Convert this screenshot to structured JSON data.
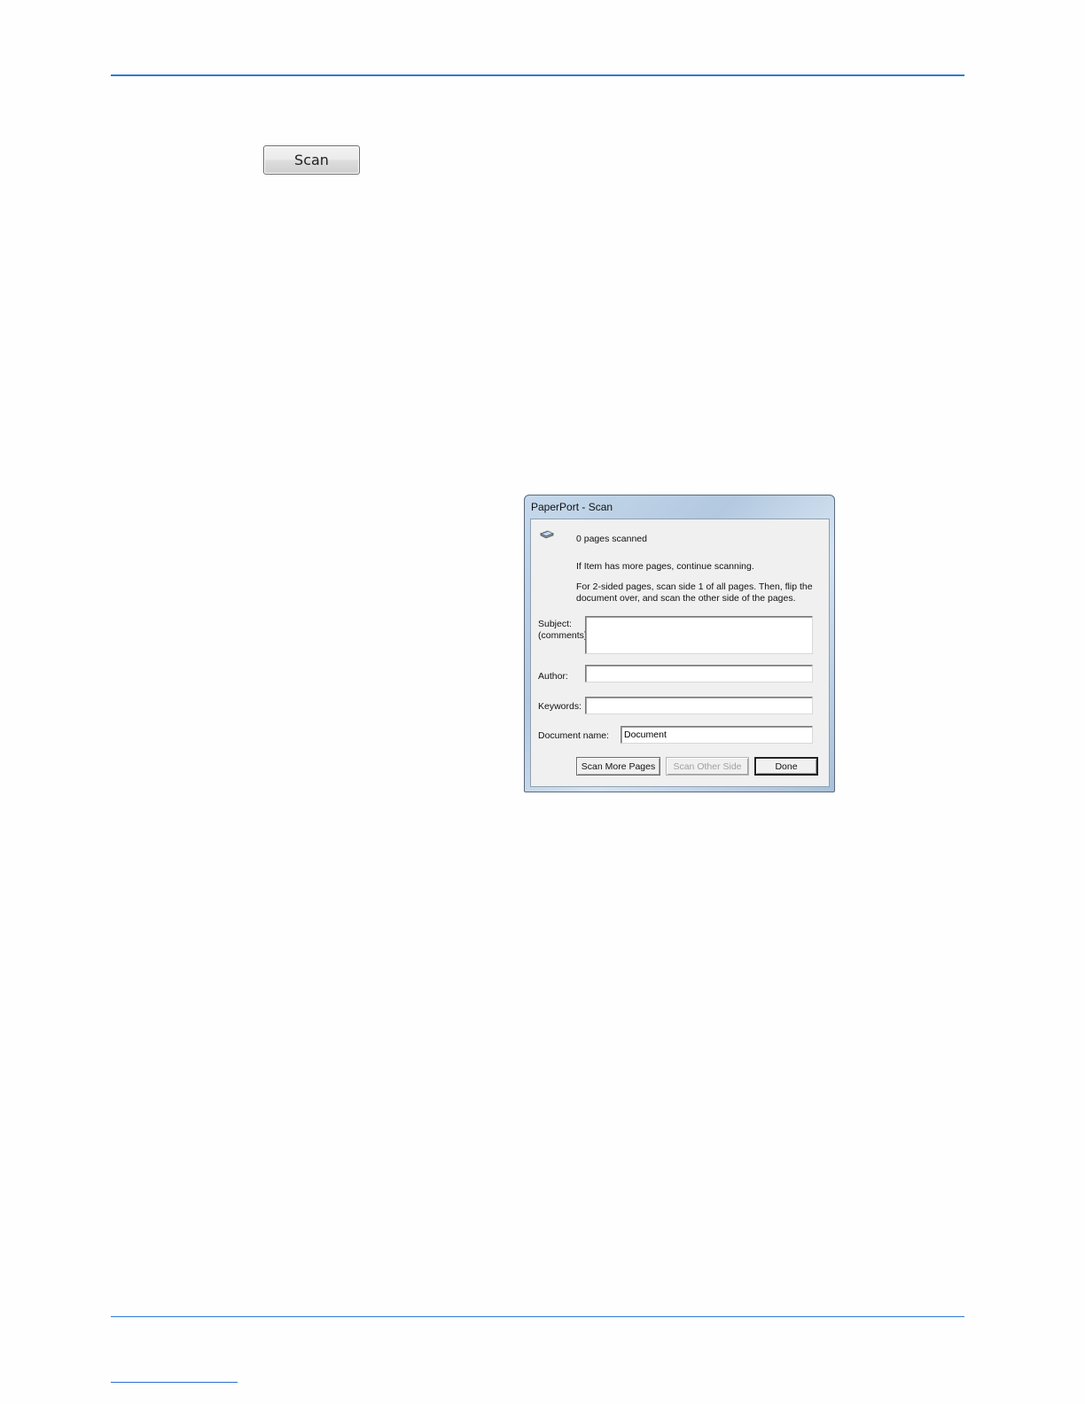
{
  "toolbar": {
    "scan_label": "Scan"
  },
  "dialog": {
    "title": "PaperPort - Scan",
    "icon": "scanner-icon",
    "status": "0 pages scanned",
    "msg_more": "If Item has more pages, continue scanning.",
    "msg_2sided_line1": "For 2-sided pages, scan side 1 of all pages. Then, flip the",
    "msg_2sided_line2": "document over, and scan the other side of the pages.",
    "subject_label_line1": "Subject:",
    "subject_label_line2": "(comments)",
    "subject_value": "",
    "author_label": "Author:",
    "author_value": "",
    "keywords_label": "Keywords:",
    "keywords_value": "",
    "docname_label": "Document name:",
    "docname_value": "Document",
    "btn_scan_more": "Scan More Pages",
    "btn_scan_other": "Scan Other Side",
    "btn_done": "Done"
  },
  "colors": {
    "rule": "#2e7bd4",
    "dialog_frame": "#b3c9e0",
    "dialog_client": "#f0f0f0"
  }
}
